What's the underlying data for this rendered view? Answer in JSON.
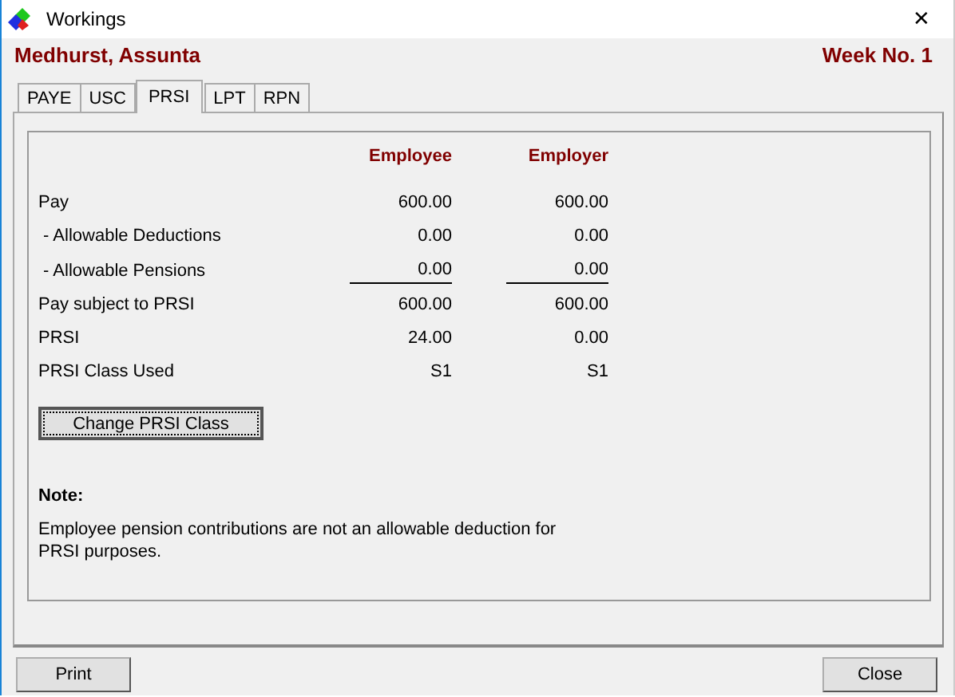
{
  "window": {
    "title": "Workings",
    "close": "✕"
  },
  "header": {
    "name": "Medhurst, Assunta",
    "week": "Week No. 1"
  },
  "tabs": [
    {
      "label": "PAYE",
      "selected": false
    },
    {
      "label": "USC",
      "selected": false
    },
    {
      "label": "PRSI",
      "selected": true
    },
    {
      "label": "LPT",
      "selected": false
    },
    {
      "label": "RPN",
      "selected": false
    }
  ],
  "table": {
    "columns": [
      "Employee",
      "Employer"
    ],
    "rows": [
      {
        "label": "Pay",
        "employee": "600.00",
        "employer": "600.00",
        "underlined": false
      },
      {
        "label": " - Allowable Deductions",
        "employee": "0.00",
        "employer": "0.00",
        "underlined": false
      },
      {
        "label": " - Allowable Pensions",
        "employee": "0.00",
        "employer": "0.00",
        "underlined": true
      },
      {
        "label": "Pay subject to PRSI",
        "employee": "600.00",
        "employer": "600.00",
        "underlined": false
      },
      {
        "label": "PRSI",
        "employee": "24.00",
        "employer": "0.00",
        "underlined": false
      },
      {
        "label": "PRSI Class Used",
        "employee": "S1",
        "employer": "S1",
        "underlined": false
      }
    ]
  },
  "change_button": "Change PRSI Class",
  "note": {
    "heading": "Note:",
    "text": "Employee pension contributions are not an allowable deduction for\nPRSI purposes."
  },
  "buttons": [
    "Print",
    "Close"
  ]
}
